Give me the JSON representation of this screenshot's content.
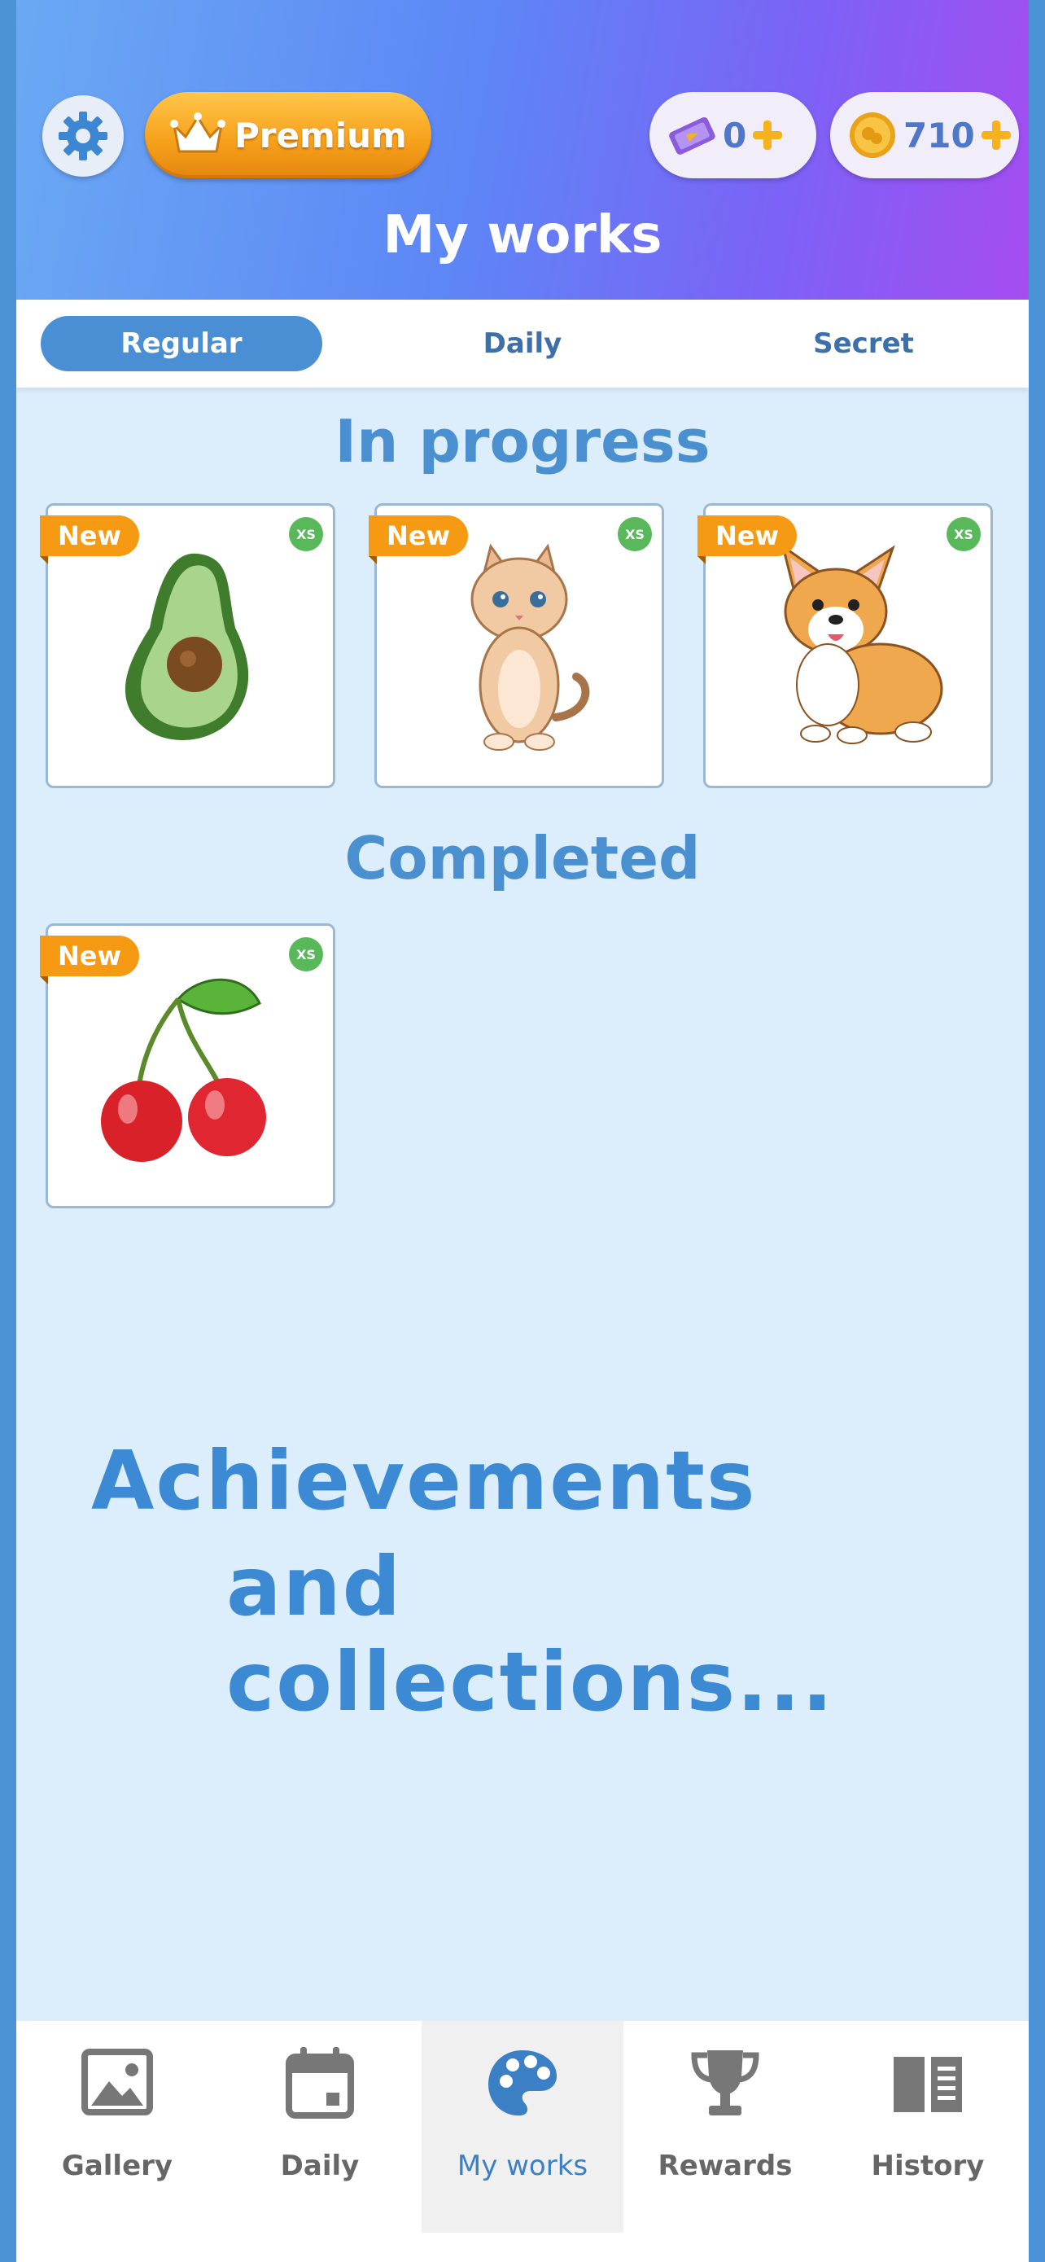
{
  "header": {
    "title": "My works",
    "premium_label": "Premium",
    "tickets": "0",
    "coins": "710"
  },
  "tabs": [
    {
      "label": "Regular",
      "active": true
    },
    {
      "label": "Daily",
      "active": false
    },
    {
      "label": "Secret",
      "active": false
    }
  ],
  "sections": {
    "in_progress_title": "In progress",
    "completed_title": "Completed"
  },
  "in_progress": [
    {
      "badge": "New",
      "size": "XS",
      "art": "avocado"
    },
    {
      "badge": "New",
      "size": "XS",
      "art": "kitten"
    },
    {
      "badge": "New",
      "size": "XS",
      "art": "corgi"
    }
  ],
  "completed": [
    {
      "badge": "New",
      "size": "XS",
      "art": "cherries"
    }
  ],
  "promo": {
    "line1": "Achievements",
    "line2": "and collections..."
  },
  "nav": [
    {
      "label": "Gallery",
      "icon": "image-icon",
      "active": false
    },
    {
      "label": "Daily",
      "icon": "calendar-icon",
      "active": false
    },
    {
      "label": "My works",
      "icon": "palette-icon",
      "active": true
    },
    {
      "label": "Rewards",
      "icon": "trophy-icon",
      "active": false
    },
    {
      "label": "History",
      "icon": "book-icon",
      "active": false
    }
  ],
  "colors": {
    "accent": "#4a8fd4",
    "premium": "#f7a21c",
    "background": "#dceefb"
  }
}
